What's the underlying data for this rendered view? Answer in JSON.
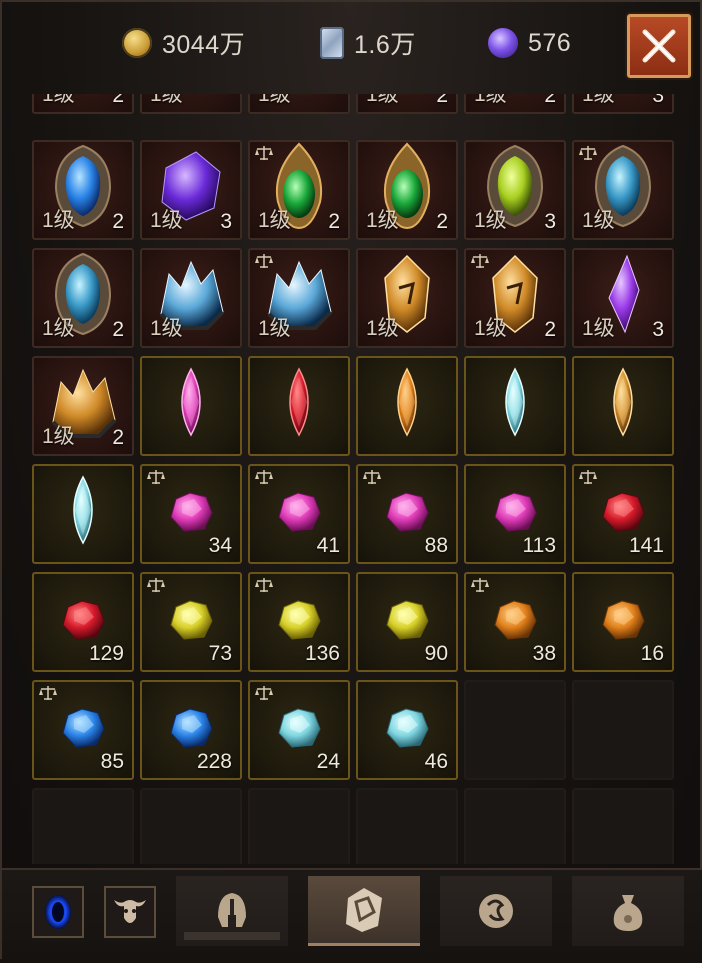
{
  "currencies": [
    {
      "icon": "gold-coin-icon",
      "value": "3044万"
    },
    {
      "icon": "scroll-icon",
      "value": "1.6万"
    },
    {
      "icon": "purple-orb-icon",
      "value": "576"
    }
  ],
  "colors": {
    "accent_close": "#b84a25",
    "slot_red": "#3b1e18",
    "slot_gold": "#6a5418"
  },
  "inventory": {
    "partial_row": [
      {
        "level": "1级",
        "count": "2"
      },
      {
        "level": "1级",
        "count": ""
      },
      {
        "level": "1级",
        "count": ""
      },
      {
        "level": "1级",
        "count": "2"
      },
      {
        "level": "1级",
        "count": "2"
      },
      {
        "level": "1级",
        "count": "3"
      }
    ],
    "rows": [
      [
        {
          "name": "blue-rune-stone-icon",
          "level": "1级",
          "count": "2",
          "bound": false
        },
        {
          "name": "purple-crystal-icon",
          "level": "1级",
          "count": "3",
          "bound": false
        },
        {
          "name": "green-emerald-amulet-icon",
          "level": "1级",
          "count": "2",
          "bound": true
        },
        {
          "name": "green-emerald-amulet-icon",
          "level": "1级",
          "count": "2",
          "bound": false
        },
        {
          "name": "yellow-green-stone-icon",
          "level": "1级",
          "count": "3",
          "bound": false
        },
        {
          "name": "teal-rune-stone-icon",
          "level": "1级",
          "count": "",
          "bound": true
        }
      ],
      [
        {
          "name": "teal-rune-stone-icon",
          "level": "1级",
          "count": "2",
          "bound": false
        },
        {
          "name": "ice-crystal-cluster-icon",
          "level": "1级",
          "count": "",
          "bound": false
        },
        {
          "name": "ice-crystal-cluster-icon",
          "level": "1级",
          "count": "",
          "bound": true
        },
        {
          "name": "amber-rune-shard-icon",
          "level": "1级",
          "count": "",
          "bound": false
        },
        {
          "name": "amber-rune-shard-icon",
          "level": "1级",
          "count": "2",
          "bound": true
        },
        {
          "name": "violet-crystal-shard-icon",
          "level": "1级",
          "count": "3",
          "bound": false
        }
      ],
      [
        {
          "name": "amber-topaz-cluster-icon",
          "level": "1级",
          "count": "2",
          "bound": false
        },
        {
          "name": "pink-marquise-gem-icon",
          "level": "",
          "count": "",
          "bound": false
        },
        {
          "name": "red-marquise-gem-icon",
          "level": "",
          "count": "",
          "bound": false
        },
        {
          "name": "orange-marquise-gem-icon",
          "level": "",
          "count": "",
          "bound": false
        },
        {
          "name": "aqua-marquise-gem-icon",
          "level": "",
          "count": "",
          "bound": false
        },
        {
          "name": "amber-marquise-gem-icon",
          "level": "",
          "count": "",
          "bound": false
        }
      ],
      [
        {
          "name": "aqua-marquise-gem-icon",
          "level": "",
          "count": "",
          "bound": false
        },
        {
          "name": "pink-rough-gem-icon",
          "level": "",
          "count": "34",
          "bound": true
        },
        {
          "name": "pink-rough-gem-icon",
          "level": "",
          "count": "41",
          "bound": true
        },
        {
          "name": "pink-rough-gem-icon",
          "level": "",
          "count": "88",
          "bound": true
        },
        {
          "name": "pink-rough-gem-icon",
          "level": "",
          "count": "113",
          "bound": false
        },
        {
          "name": "red-rough-gem-icon",
          "level": "",
          "count": "141",
          "bound": true
        }
      ],
      [
        {
          "name": "red-rough-gem-icon",
          "level": "",
          "count": "129",
          "bound": false
        },
        {
          "name": "yellow-rough-gem-icon",
          "level": "",
          "count": "73",
          "bound": true
        },
        {
          "name": "yellow-rough-gem-icon",
          "level": "",
          "count": "136",
          "bound": true
        },
        {
          "name": "yellow-rough-gem-icon",
          "level": "",
          "count": "90",
          "bound": false
        },
        {
          "name": "orange-rough-gem-icon",
          "level": "",
          "count": "38",
          "bound": true
        },
        {
          "name": "orange-rough-gem-icon",
          "level": "",
          "count": "16",
          "bound": false
        }
      ],
      [
        {
          "name": "blue-rough-gem-icon",
          "level": "",
          "count": "85",
          "bound": true
        },
        {
          "name": "blue-rough-gem-icon",
          "level": "",
          "count": "228",
          "bound": false
        },
        {
          "name": "aqua-rough-gem-icon",
          "level": "",
          "count": "24",
          "bound": true
        },
        {
          "name": "aqua-rough-gem-icon",
          "level": "",
          "count": "46",
          "bound": false
        },
        {
          "name": "empty-slot",
          "level": "",
          "count": "",
          "bound": false
        },
        {
          "name": "empty-slot",
          "level": "",
          "count": "",
          "bound": false
        }
      ]
    ]
  },
  "bottom_nav": {
    "buttons": [
      {
        "name": "blue-portal-icon"
      },
      {
        "name": "bull-skull-icon"
      }
    ],
    "tabs": [
      {
        "name": "tab-equipment",
        "icon": "helmet-icon",
        "active": false
      },
      {
        "name": "tab-gems",
        "icon": "gem-rune-icon",
        "active": true
      },
      {
        "name": "tab-materials",
        "icon": "rune-stone-icon",
        "active": false
      },
      {
        "name": "tab-bag",
        "icon": "coin-bag-icon",
        "active": false
      }
    ]
  }
}
